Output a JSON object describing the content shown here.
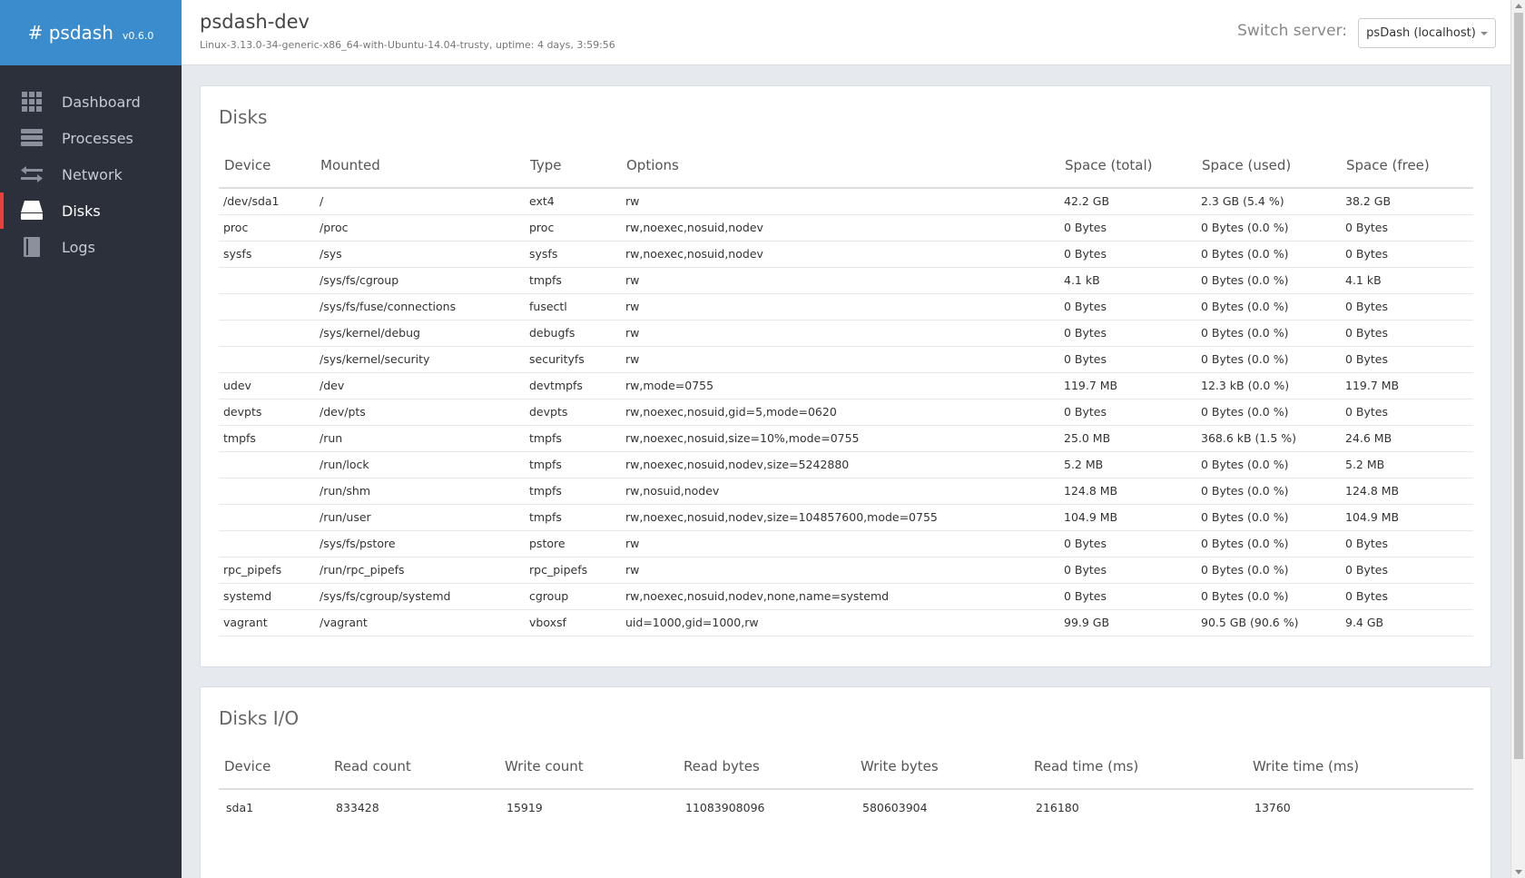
{
  "brand": {
    "name": "# psdash",
    "version": "v0.6.0"
  },
  "sidebar": {
    "items": [
      {
        "label": "Dashboard",
        "icon": "grid-icon"
      },
      {
        "label": "Processes",
        "icon": "server-icon"
      },
      {
        "label": "Network",
        "icon": "exchange-icon"
      },
      {
        "label": "Disks",
        "icon": "hdd-icon",
        "active": true
      },
      {
        "label": "Logs",
        "icon": "book-icon"
      }
    ]
  },
  "header": {
    "hostname": "psdash-dev",
    "sysinfo": "Linux-3.13.0-34-generic-x86_64-with-Ubuntu-14.04-trusty, uptime: 4 days, 3:59:56",
    "switch_label": "Switch server:",
    "switch_value": "psDash (localhost)"
  },
  "colors": {
    "sidebar_bg": "#2c303b",
    "brand_bg": "#3b8ccd",
    "active_marker": "#e5413f",
    "page_bg": "#e6e9ee"
  },
  "disks": {
    "title": "Disks",
    "columns": [
      "Device",
      "Mounted",
      "Type",
      "Options",
      "Space (total)",
      "Space (used)",
      "Space (free)"
    ],
    "rows": [
      [
        "/dev/sda1",
        "/",
        "ext4",
        "rw",
        "42.2 GB",
        "2.3 GB (5.4 %)",
        "38.2 GB"
      ],
      [
        "proc",
        "/proc",
        "proc",
        "rw,noexec,nosuid,nodev",
        "0 Bytes",
        "0 Bytes (0.0 %)",
        "0 Bytes"
      ],
      [
        "sysfs",
        "/sys",
        "sysfs",
        "rw,noexec,nosuid,nodev",
        "0 Bytes",
        "0 Bytes (0.0 %)",
        "0 Bytes"
      ],
      [
        "",
        "/sys/fs/cgroup",
        "tmpfs",
        "rw",
        "4.1 kB",
        "0 Bytes (0.0 %)",
        "4.1 kB"
      ],
      [
        "",
        "/sys/fs/fuse/connections",
        "fusectl",
        "rw",
        "0 Bytes",
        "0 Bytes (0.0 %)",
        "0 Bytes"
      ],
      [
        "",
        "/sys/kernel/debug",
        "debugfs",
        "rw",
        "0 Bytes",
        "0 Bytes (0.0 %)",
        "0 Bytes"
      ],
      [
        "",
        "/sys/kernel/security",
        "securityfs",
        "rw",
        "0 Bytes",
        "0 Bytes (0.0 %)",
        "0 Bytes"
      ],
      [
        "udev",
        "/dev",
        "devtmpfs",
        "rw,mode=0755",
        "119.7 MB",
        "12.3 kB (0.0 %)",
        "119.7 MB"
      ],
      [
        "devpts",
        "/dev/pts",
        "devpts",
        "rw,noexec,nosuid,gid=5,mode=0620",
        "0 Bytes",
        "0 Bytes (0.0 %)",
        "0 Bytes"
      ],
      [
        "tmpfs",
        "/run",
        "tmpfs",
        "rw,noexec,nosuid,size=10%,mode=0755",
        "25.0 MB",
        "368.6 kB (1.5 %)",
        "24.6 MB"
      ],
      [
        "",
        "/run/lock",
        "tmpfs",
        "rw,noexec,nosuid,nodev,size=5242880",
        "5.2 MB",
        "0 Bytes (0.0 %)",
        "5.2 MB"
      ],
      [
        "",
        "/run/shm",
        "tmpfs",
        "rw,nosuid,nodev",
        "124.8 MB",
        "0 Bytes (0.0 %)",
        "124.8 MB"
      ],
      [
        "",
        "/run/user",
        "tmpfs",
        "rw,noexec,nosuid,nodev,size=104857600,mode=0755",
        "104.9 MB",
        "0 Bytes (0.0 %)",
        "104.9 MB"
      ],
      [
        "",
        "/sys/fs/pstore",
        "pstore",
        "rw",
        "0 Bytes",
        "0 Bytes (0.0 %)",
        "0 Bytes"
      ],
      [
        "rpc_pipefs",
        "/run/rpc_pipefs",
        "rpc_pipefs",
        "rw",
        "0 Bytes",
        "0 Bytes (0.0 %)",
        "0 Bytes"
      ],
      [
        "systemd",
        "/sys/fs/cgroup/systemd",
        "cgroup",
        "rw,noexec,nosuid,nodev,none,name=systemd",
        "0 Bytes",
        "0 Bytes (0.0 %)",
        "0 Bytes"
      ],
      [
        "vagrant",
        "/vagrant",
        "vboxsf",
        "uid=1000,gid=1000,rw",
        "99.9 GB",
        "90.5 GB (90.6 %)",
        "9.4 GB"
      ]
    ]
  },
  "disks_io": {
    "title": "Disks I/O",
    "columns": [
      "Device",
      "Read count",
      "Write count",
      "Read bytes",
      "Write bytes",
      "Read time (ms)",
      "Write time (ms)"
    ],
    "rows": [
      [
        "sda1",
        "833428",
        "15919",
        "11083908096",
        "580603904",
        "216180",
        "13760"
      ]
    ]
  }
}
